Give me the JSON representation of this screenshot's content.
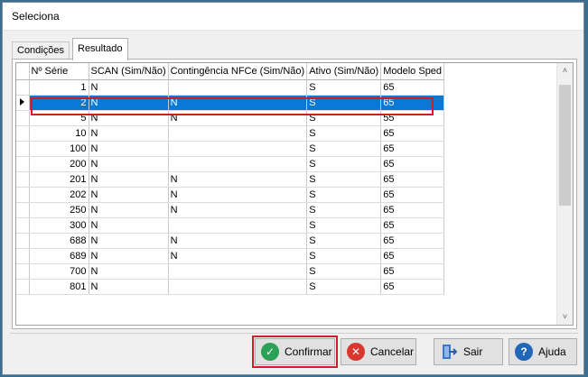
{
  "window": {
    "title": "Seleciona"
  },
  "tabs": [
    {
      "label": "Condições"
    },
    {
      "label": "Resultado"
    }
  ],
  "grid": {
    "columns": [
      "Nº Série",
      "SCAN (Sim/Não)",
      "Contingência NFCe (Sim/Não)",
      "Ativo (Sim/Não)",
      "Modelo Sped"
    ],
    "rows": [
      [
        "1",
        "N",
        "",
        "S",
        "65"
      ],
      [
        "2",
        "N",
        "N",
        "S",
        "65"
      ],
      [
        "5",
        "N",
        "N",
        "S",
        "55"
      ],
      [
        "10",
        "N",
        "",
        "S",
        "65"
      ],
      [
        "100",
        "N",
        "",
        "S",
        "65"
      ],
      [
        "200",
        "N",
        "",
        "S",
        "65"
      ],
      [
        "201",
        "N",
        "N",
        "S",
        "65"
      ],
      [
        "202",
        "N",
        "N",
        "S",
        "65"
      ],
      [
        "250",
        "N",
        "N",
        "S",
        "65"
      ],
      [
        "300",
        "N",
        "",
        "S",
        "65"
      ],
      [
        "688",
        "N",
        "N",
        "S",
        "65"
      ],
      [
        "689",
        "N",
        "N",
        "S",
        "65"
      ],
      [
        "700",
        "N",
        "",
        "S",
        "65"
      ],
      [
        "801",
        "N",
        "",
        "S",
        "65"
      ]
    ],
    "selected_row": 1
  },
  "buttons": {
    "confirm": "Confirmar",
    "cancel": "Cancelar",
    "exit": "Sair",
    "help": "Ajuda"
  },
  "icons": {
    "confirm": "check-circle-icon",
    "cancel": "x-circle-icon",
    "exit": "exit-door-icon",
    "help": "question-circle-icon"
  },
  "colors": {
    "selection": "#0a78d7",
    "highlight_outline": "#d11c2a",
    "confirm_icon": "#2aa154",
    "cancel_icon": "#d8372f",
    "help_icon": "#2166b9"
  }
}
